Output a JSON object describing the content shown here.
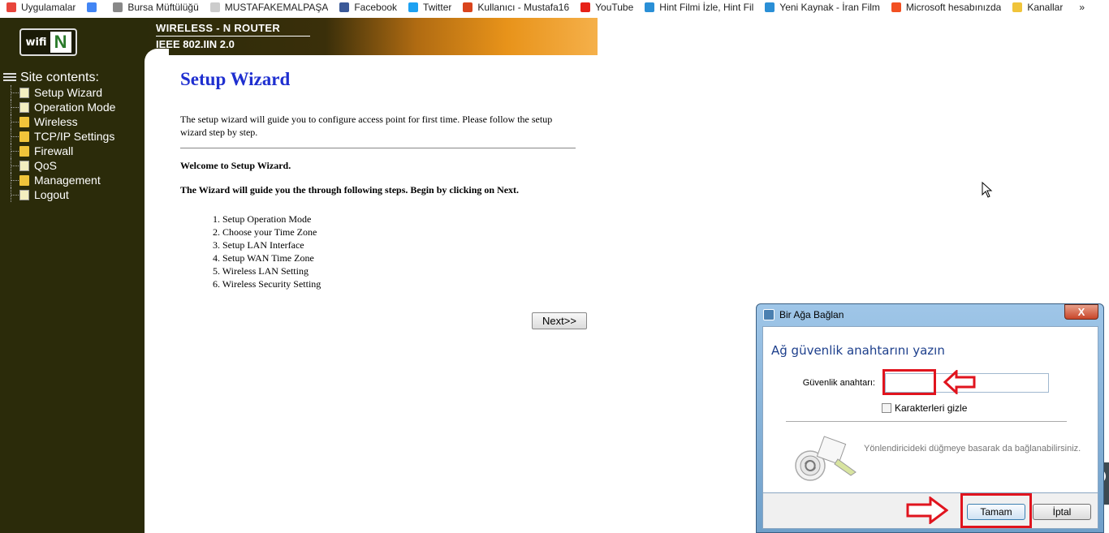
{
  "bookmarks": [
    {
      "label": "Uygulamalar",
      "icon": "apps-grid-icon",
      "color": "#e8453c"
    },
    {
      "label": "",
      "icon": "google-icon",
      "color": "#4285f4"
    },
    {
      "label": "Bursa Müftülüğü",
      "icon": "page-icon",
      "color": "#888888"
    },
    {
      "label": "MUSTAFAKEMALPAŞA",
      "icon": "page-icon",
      "color": "#cccccc"
    },
    {
      "label": "Facebook",
      "icon": "facebook-icon",
      "color": "#3b5998"
    },
    {
      "label": "Twitter",
      "icon": "twitter-icon",
      "color": "#1da1f2"
    },
    {
      "label": "Kullanıcı - Mustafa16",
      "icon": "user-icon",
      "color": "#d9441c"
    },
    {
      "label": "YouTube",
      "icon": "youtube-icon",
      "color": "#e62117"
    },
    {
      "label": "Hint Filmi İzle, Hint Fil",
      "icon": "film-icon",
      "color": "#2a8fd6"
    },
    {
      "label": "Yeni Kaynak - İran Film",
      "icon": "film-icon",
      "color": "#2a8fd6"
    },
    {
      "label": "Microsoft hesabınızda",
      "icon": "microsoft-icon",
      "color": "#f25022"
    },
    {
      "label": "Kanallar",
      "icon": "folder-icon",
      "color": "#f0c43a"
    },
    {
      "label": "»",
      "icon": "more-icon",
      "color": "#333333"
    }
  ],
  "banner": {
    "line1": "WIRELESS - N ROUTER",
    "line2": "IEEE 802.IIN 2.0",
    "logo_text": "wifi",
    "logo_badge": "N"
  },
  "menu": {
    "root": "Site contents:",
    "items": [
      {
        "label": "Setup Wizard",
        "icon": "doc"
      },
      {
        "label": "Operation Mode",
        "icon": "doc"
      },
      {
        "label": "Wireless",
        "icon": "folder"
      },
      {
        "label": "TCP/IP Settings",
        "icon": "folder"
      },
      {
        "label": "Firewall",
        "icon": "folder"
      },
      {
        "label": "QoS",
        "icon": "doc"
      },
      {
        "label": "Management",
        "icon": "folder"
      },
      {
        "label": "Logout",
        "icon": "doc"
      }
    ]
  },
  "main": {
    "title": "Setup Wizard",
    "intro": "The setup wizard will guide you to configure access point for first time. Please follow the setup wizard step by step.",
    "welcome": "Welcome to Setup Wizard.",
    "guide": "The Wizard will guide you the through following steps. Begin by clicking on Next.",
    "steps": [
      "1. Setup Operation Mode",
      "2. Choose your Time Zone",
      "3. Setup LAN Interface",
      "4. Setup WAN Time Zone",
      "5. Wireless LAN Setting",
      "6. Wireless Security Setting"
    ],
    "next_label": "Next>>"
  },
  "dialog": {
    "title": "Bir Ağa Bağlan",
    "close_label": "X",
    "heading": "Ağ güvenlik anahtarını yazın",
    "key_label": "Güvenlik anahtarı:",
    "key_value": "",
    "hide_chars_label": "Karakterleri gizle",
    "hide_chars_checked": false,
    "wps_text": "Yönlendiricideki düğmeye basarak da bağlanabilirsiniz.",
    "ok_label": "Tamam",
    "cancel_label": "İptal"
  },
  "colors": {
    "sidebar_bg": "#2b2b0a",
    "title_blue": "#1f2fd0",
    "annotation_red": "#e0141e"
  }
}
